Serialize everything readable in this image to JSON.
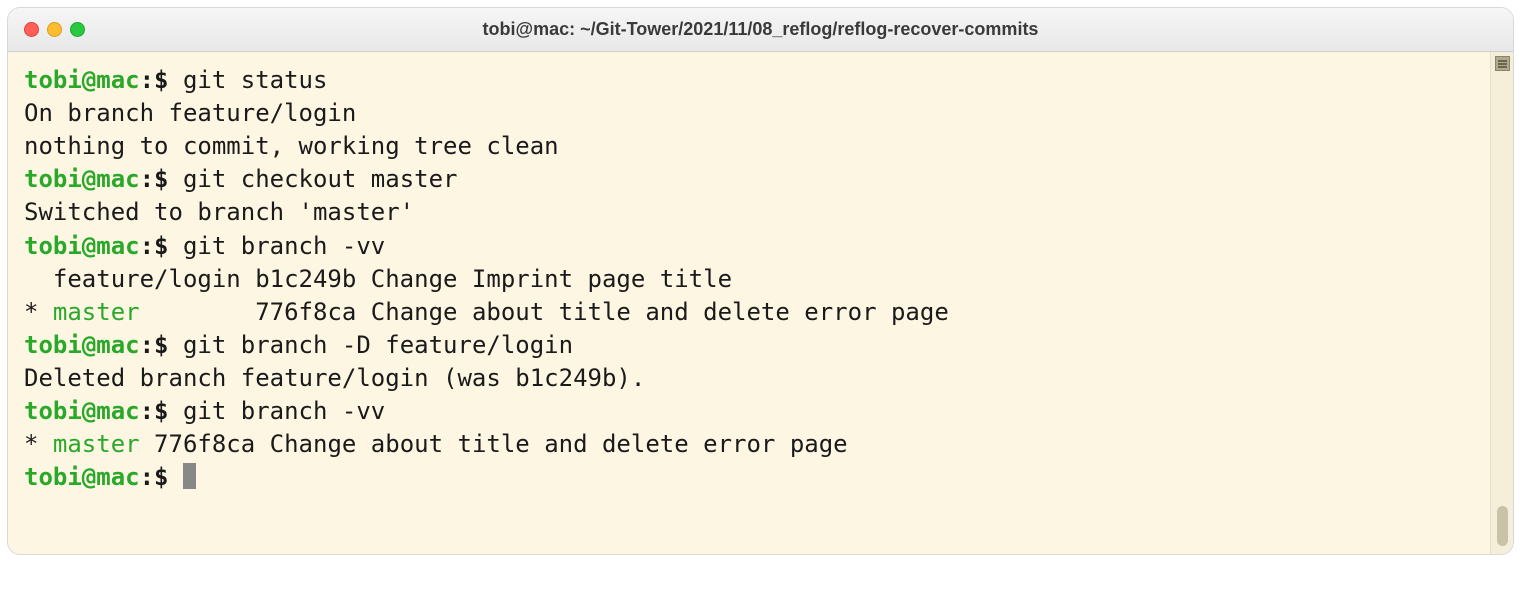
{
  "window": {
    "title": "tobi@mac: ~/Git-Tower/2021/11/08_reflog/reflog-recover-commits"
  },
  "prompt": {
    "user_host": "tobi@mac",
    "sep": ":",
    "symbol": "$ "
  },
  "session": [
    {
      "type": "cmd",
      "text": "git status"
    },
    {
      "type": "out",
      "text": "On branch feature/login"
    },
    {
      "type": "out",
      "text": "nothing to commit, working tree clean"
    },
    {
      "type": "cmd",
      "text": "git checkout master"
    },
    {
      "type": "out",
      "text": "Switched to branch 'master'"
    },
    {
      "type": "cmd",
      "text": "git branch -vv"
    },
    {
      "type": "out",
      "text": "  feature/login b1c249b Change Imprint page title"
    },
    {
      "type": "branch-active",
      "star": "* ",
      "name": "master",
      "rest": "        776f8ca Change about title and delete error page"
    },
    {
      "type": "cmd",
      "text": "git branch -D feature/login"
    },
    {
      "type": "out",
      "text": "Deleted branch feature/login (was b1c249b)."
    },
    {
      "type": "cmd",
      "text": "git branch -vv"
    },
    {
      "type": "branch-active",
      "star": "* ",
      "name": "master",
      "rest": " 776f8ca Change about title and delete error page"
    },
    {
      "type": "cmd-cursor",
      "text": ""
    }
  ]
}
